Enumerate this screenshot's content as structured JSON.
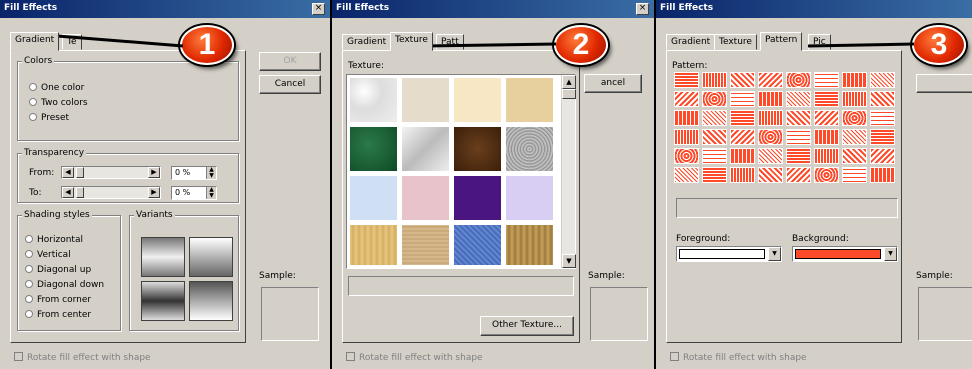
{
  "colors": {
    "titlebar": "#0a246a",
    "callout": "#e02800",
    "dialog": "#d4d0c8",
    "pattern_fore": "#ff4a2a"
  },
  "panels": [
    {
      "title": "Fill Effects",
      "close": "×",
      "tabs": [
        "Gradient",
        "Te"
      ],
      "buttons": {
        "ok": "OK",
        "cancel": "Cancel"
      },
      "colors_group": {
        "label": "Colors",
        "options": [
          "One color",
          "Two colors",
          "Preset"
        ]
      },
      "transparency": {
        "label": "Transparency",
        "from_label": "From:",
        "to_label": "To:",
        "from_value": "0 %",
        "to_value": "0 %"
      },
      "shading": {
        "label": "Shading styles",
        "options": [
          "Horizontal",
          "Vertical",
          "Diagonal up",
          "Diagonal down",
          "From corner",
          "From center"
        ]
      },
      "variants_label": "Variants",
      "sample_label": "Sample:",
      "rotate_label": "Rotate fill effect with shape",
      "callout": "1"
    },
    {
      "title": "Fill Effects",
      "close": "×",
      "tabs": [
        "Gradient",
        "Texture",
        "Patt"
      ],
      "buttons": {
        "cancel": "ancel",
        "other": "Other Texture..."
      },
      "texture_label": "Texture:",
      "sample_label": "Sample:",
      "rotate_label": "Rotate fill effect with shape",
      "callout": "2"
    },
    {
      "title": "Fill Effects",
      "tabs": [
        "Gradient",
        "Texture",
        "Pattern",
        "Pic"
      ],
      "pattern_label": "Pattern:",
      "foreground_label": "Foreground:",
      "background_label": "Background:",
      "foreground_color": "#ffffff",
      "background_color": "#ff4a2a",
      "sample_label": "Sample:",
      "rotate_label": "Rotate fill effect with shape",
      "callout": "3"
    }
  ]
}
